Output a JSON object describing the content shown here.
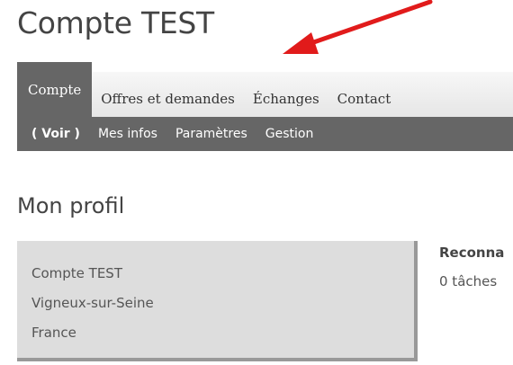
{
  "header": {
    "title": "Compte TEST"
  },
  "annotation": {
    "arrow_color": "#e11b1b"
  },
  "primary_tabs": [
    {
      "label": "Compte",
      "active": true
    },
    {
      "label": "Offres et demandes",
      "active": false
    },
    {
      "label": "Échanges",
      "active": false
    },
    {
      "label": "Contact",
      "active": false
    }
  ],
  "secondary_tabs": [
    {
      "label": "( Voir )",
      "active": true
    },
    {
      "label": "Mes infos",
      "active": false
    },
    {
      "label": "Paramètres",
      "active": false
    },
    {
      "label": "Gestion",
      "active": false
    }
  ],
  "main": {
    "section_title": "Mon profil",
    "profile": {
      "name": "Compte TEST",
      "city": "Vigneux-sur-Seine",
      "country": "France"
    },
    "side": {
      "heading": "Reconna",
      "text": "0 tâches"
    }
  }
}
